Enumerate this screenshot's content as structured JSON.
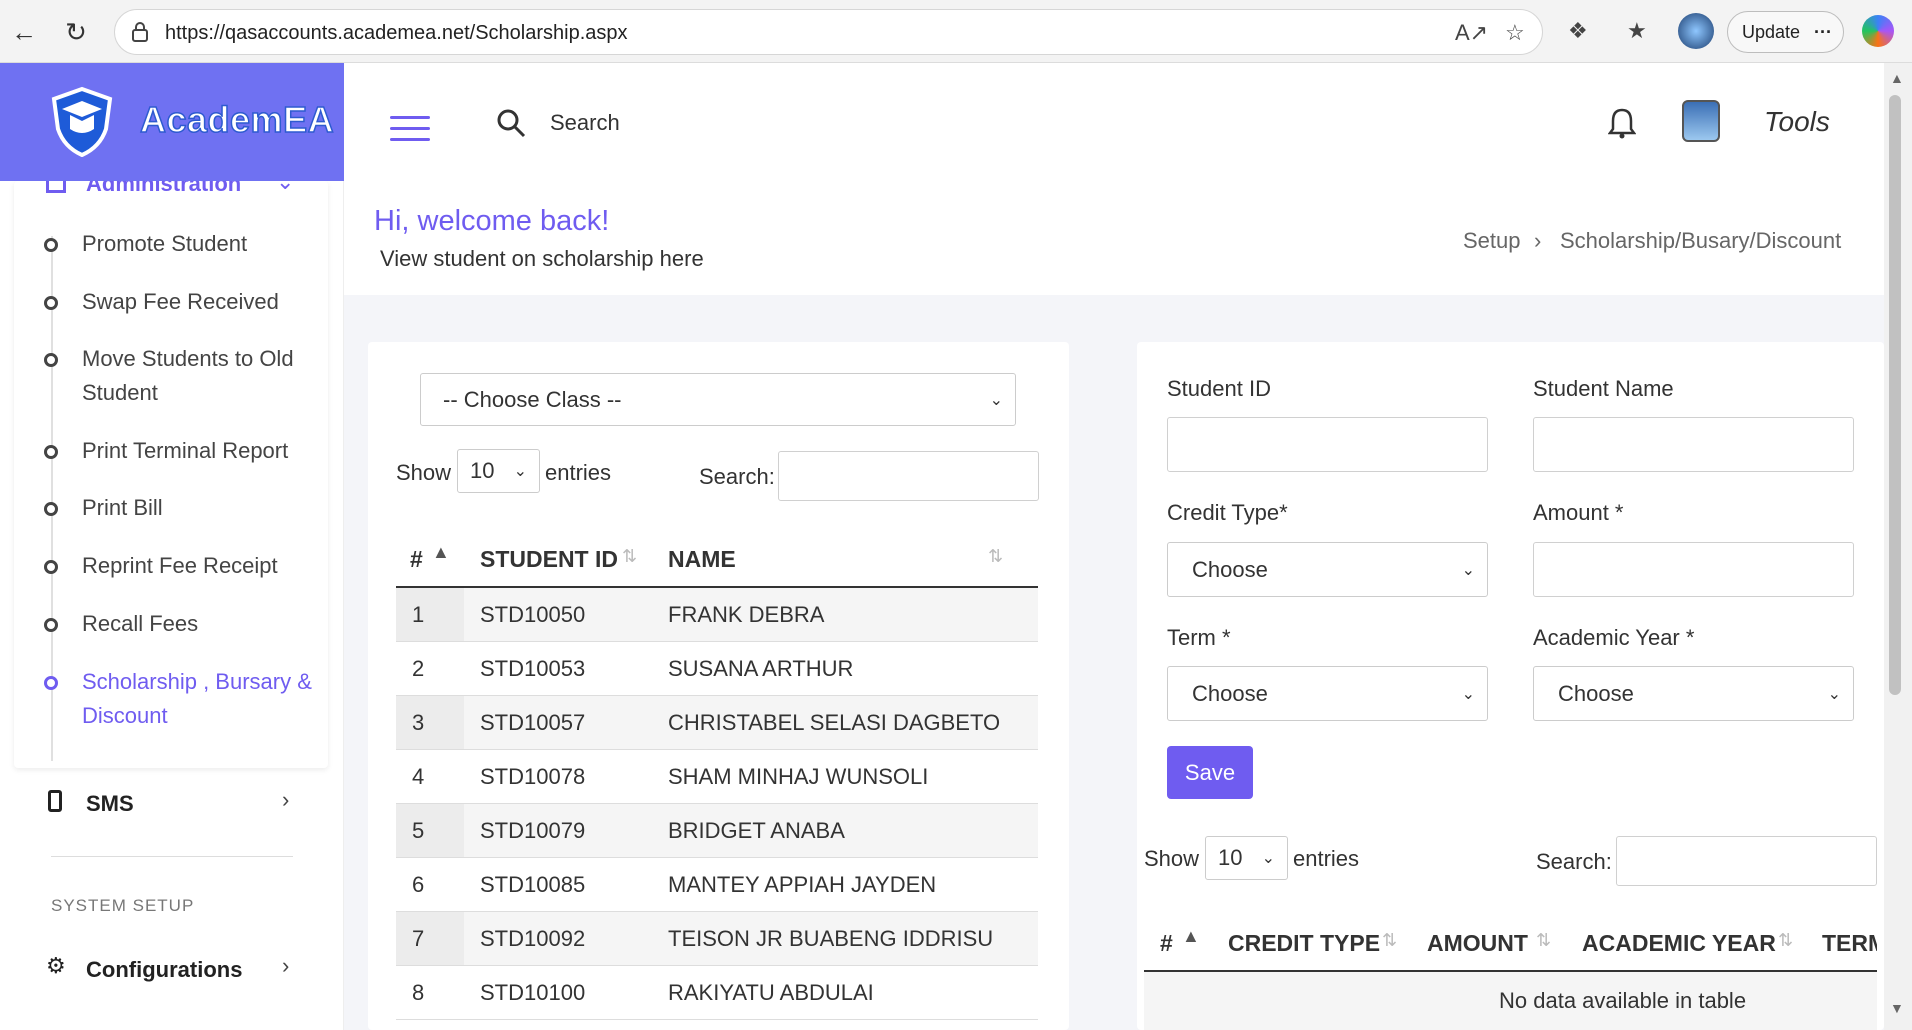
{
  "browser": {
    "url": "https://qasaccounts.academea.net/Scholarship.aspx",
    "update_label": "Update",
    "more_label": "···"
  },
  "brand": {
    "name": "AcademEA"
  },
  "header": {
    "search_label": "Search",
    "tools_label": "Tools"
  },
  "sidebar": {
    "section_title": "Administration",
    "items": [
      {
        "label": "Promote Student"
      },
      {
        "label": "Swap Fee Received"
      },
      {
        "label": "Move Students to Old Student"
      },
      {
        "label": "Print Terminal Report"
      },
      {
        "label": "Print Bill"
      },
      {
        "label": "Reprint Fee Receipt"
      },
      {
        "label": "Recall Fees"
      },
      {
        "label": "Scholarship , Bursary & Discount"
      }
    ],
    "sms_label": "SMS",
    "system_setup_label": "SYSTEM SETUP",
    "configurations_label": "Configurations"
  },
  "page": {
    "greeting": "Hi, welcome back!",
    "subtitle": "View student on scholarship here",
    "breadcrumb": [
      "Setup",
      "Scholarship/Busary/Discount"
    ]
  },
  "left_panel": {
    "class_select": "-- Choose Class --",
    "show_label": "Show",
    "entries_value": "10",
    "entries_label": "entries",
    "search_label": "Search:",
    "columns": [
      "#",
      "STUDENT ID",
      "NAME"
    ],
    "rows": [
      {
        "n": "1",
        "id": "STD10050",
        "name": "FRANK DEBRA"
      },
      {
        "n": "2",
        "id": "STD10053",
        "name": "SUSANA ARTHUR"
      },
      {
        "n": "3",
        "id": "STD10057",
        "name": "CHRISTABEL SELASI DAGBETO"
      },
      {
        "n": "4",
        "id": "STD10078",
        "name": "SHAM MINHAJ WUNSOLI"
      },
      {
        "n": "5",
        "id": "STD10079",
        "name": "BRIDGET ANABA"
      },
      {
        "n": "6",
        "id": "STD10085",
        "name": "MANTEY APPIAH JAYDEN"
      },
      {
        "n": "7",
        "id": "STD10092",
        "name": "TEISON JR BUABENG IDDRISU"
      },
      {
        "n": "8",
        "id": "STD10100",
        "name": "RAKIYATU ABDULAI"
      }
    ]
  },
  "right_panel": {
    "student_id_label": "Student ID",
    "student_name_label": "Student Name",
    "credit_type_label": "Credit Type*",
    "credit_type_value": "Choose",
    "amount_label": "Amount *",
    "term_label": "Term *",
    "term_value": "Choose",
    "academic_year_label": "Academic Year *",
    "academic_year_value": "Choose",
    "save_label": "Save",
    "show_label": "Show",
    "entries_value": "10",
    "entries_label": "entries",
    "search_label": "Search:",
    "columns": [
      "#",
      "CREDIT TYPE",
      "AMOUNT",
      "ACADEMIC YEAR",
      "TERM"
    ],
    "empty_message": "No data available in table"
  }
}
